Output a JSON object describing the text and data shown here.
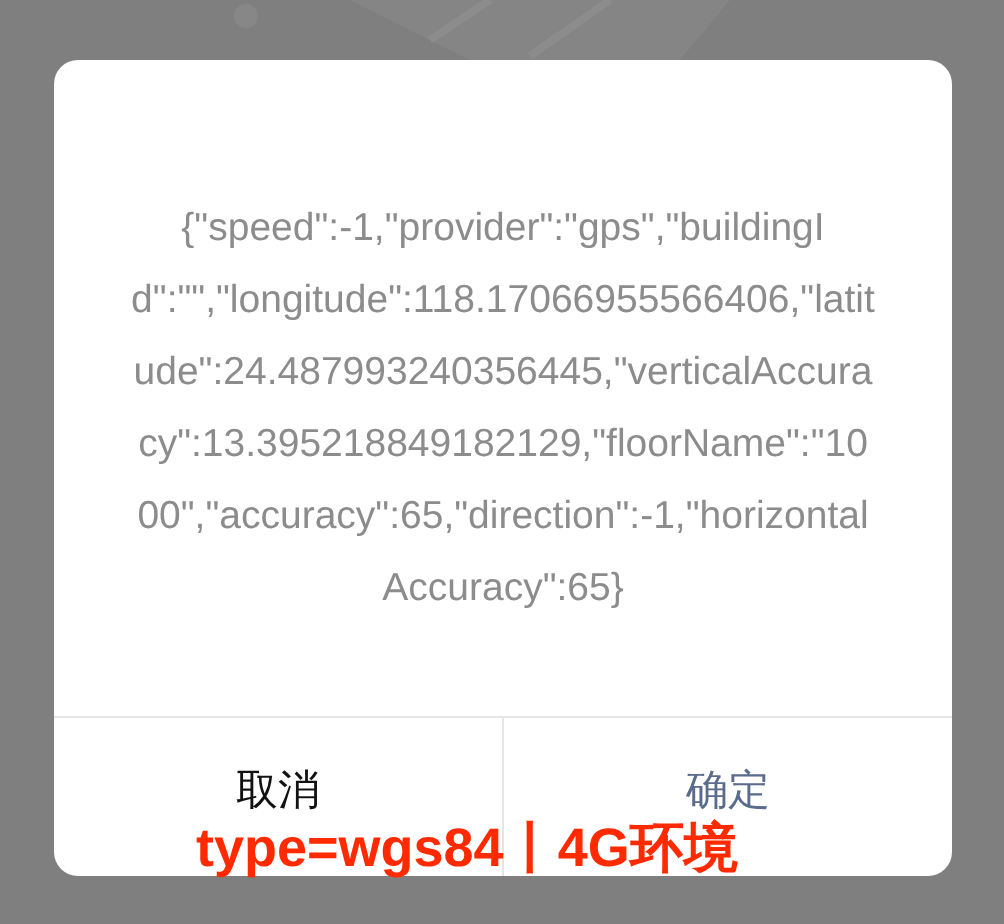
{
  "dialog": {
    "message": "{\"speed\":-1,\"provider\":\"gps\",\"buildingId\":\"\",\"longitude\":118.17066955566406,\"latitude\":24.487993240356445,\"verticalAccuracy\":13.395218849182129,\"floorName\":\"1000\",\"accuracy\":65,\"direction\":-1,\"horizontalAccuracy\":65}",
    "buttons": [
      {
        "label": "取消",
        "kind": "cancel"
      },
      {
        "label": "确定",
        "kind": "confirm"
      }
    ]
  },
  "annotation": "type=wgs84丨4G环境"
}
